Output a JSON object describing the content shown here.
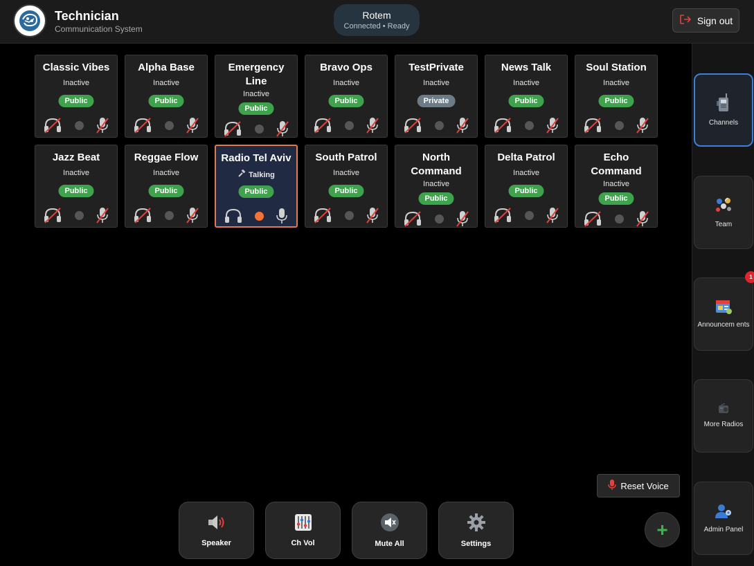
{
  "header": {
    "title": "Technician",
    "subtitle": "Communication System",
    "user_name": "Rotem",
    "user_status": "Connected • Ready",
    "signout_label": "Sign out"
  },
  "channels": [
    {
      "name": "Classic Vibes",
      "status": "Inactive",
      "badge": "Public",
      "active": false
    },
    {
      "name": "Alpha Base",
      "status": "Inactive",
      "badge": "Public",
      "active": false
    },
    {
      "name": "Emergency Line",
      "status": "Inactive",
      "badge": "Public",
      "active": false
    },
    {
      "name": "Bravo Ops",
      "status": "Inactive",
      "badge": "Public",
      "active": false
    },
    {
      "name": "TestPrivate",
      "status": "Inactive",
      "badge": "Private",
      "active": false
    },
    {
      "name": "News Talk",
      "status": "Inactive",
      "badge": "Public",
      "active": false
    },
    {
      "name": "Soul Station",
      "status": "Inactive",
      "badge": "Public",
      "active": false
    },
    {
      "name": "Jazz Beat",
      "status": "Inactive",
      "badge": "Public",
      "active": false
    },
    {
      "name": "Reggae Flow",
      "status": "Inactive",
      "badge": "Public",
      "active": false
    },
    {
      "name": "Radio Tel Aviv",
      "status": "Talking",
      "badge": "Public",
      "active": true
    },
    {
      "name": "South Patrol",
      "status": "Inactive",
      "badge": "Public",
      "active": false
    },
    {
      "name": "North Command",
      "status": "Inactive",
      "badge": "Public",
      "active": false
    },
    {
      "name": "Delta Patrol",
      "status": "Inactive",
      "badge": "Public",
      "active": false
    },
    {
      "name": "Echo Command",
      "status": "Inactive",
      "badge": "Public",
      "active": false
    }
  ],
  "controls": {
    "speaker": "Speaker",
    "ch_vol": "Ch Vol",
    "mute_all": "Mute All",
    "settings": "Settings",
    "reset_voice": "Reset Voice",
    "add": "+"
  },
  "sidebar": {
    "items": [
      {
        "label": "Channels",
        "icon": "walkie-talkie-icon",
        "active": true
      },
      {
        "label": "Team",
        "icon": "team-icon",
        "active": false
      },
      {
        "label": "Announcem ents",
        "icon": "announcement-icon",
        "active": false,
        "badge": "1"
      },
      {
        "label": "More Radios",
        "icon": "radio-icon",
        "active": false
      },
      {
        "label": "Admin Panel",
        "icon": "admin-icon",
        "active": false
      }
    ]
  },
  "colors": {
    "public": "#3fa34d",
    "private": "#6c7b86",
    "accent": "#3f7fd9",
    "talking_dot": "#f27238",
    "active_border": "#e07a50"
  }
}
